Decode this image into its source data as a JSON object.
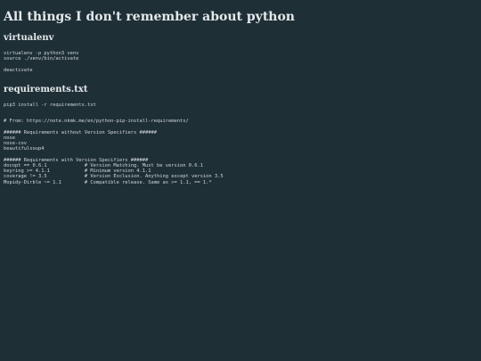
{
  "page_title": "All things I don't remember about python",
  "sections": [
    {
      "title": "virtualenv",
      "code": "virtualenv -p python3 venv\nsource ./venv/bin/activate\n\ndeactivate"
    },
    {
      "title": "requirements.txt",
      "code": "pip3 install -r requirements.txt\n\n\n# From: https://note.nkmk.me/en/python-pip-install-requirements/\n\n###### Requirements without Version Specifiers ######\nnose\nnose-cov\nbeautifulsoup4\n\n###### Requirements with Version Specifiers ######\ndocopt == 0.6.1             # Version Matching. Must be version 0.6.1\nkeyring >= 4.1.1            # Minimum version 4.1.1\ncoverage != 3.5             # Version Exclusion. Anything except version 3.5\nMopidy-Dirble ~= 1.1        # Compatible release. Same as >= 1.1, == 1.*"
    }
  ]
}
